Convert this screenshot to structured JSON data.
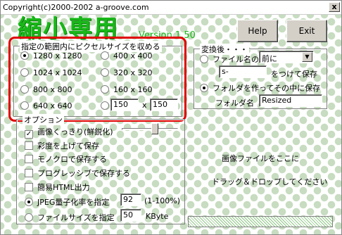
{
  "window": {
    "title": "Copyright(c)2000-2002 a-groove.com",
    "close_label": "x",
    "logo": "縮小専用",
    "version": "Version 1.50"
  },
  "buttons": {
    "help": "Help",
    "exit": "Exit"
  },
  "size_group": {
    "legend": "指定の範囲内にピクセルサイズを収める",
    "options": [
      "1280 x 1280",
      "400 x 400",
      "1024 x 1024",
      "320 x 320",
      "800 x 800",
      "160 x 160",
      "640 x 640"
    ],
    "custom_width": "150",
    "custom_x": "x",
    "custom_height": "150"
  },
  "convert_group": {
    "legend": "変換後・・・",
    "filename_label": "ファイル名の",
    "position_select": "前に",
    "prefix_value": "s-",
    "prefix_suffix_label": "をつけて保存",
    "folder_option_label": "フォルダを作ってその中に保存",
    "folder_name_label": "フォルダ名",
    "folder_name_value": "Resized"
  },
  "options_group": {
    "legend": "オプション",
    "sharpen": "画像くっきり(鮮鋭化)",
    "saturation": "彩度を上げて保存",
    "monochrome": "モノクロで保存する",
    "progressive": "プログレッシブで保存する",
    "simple_html": "簡易HTML出力",
    "jpeg_quality_label": "JPEG量子化率を指定",
    "jpeg_quality_value": "92",
    "jpeg_quality_range": "(1-100%)",
    "file_size_label": "ファイルサイズを指定",
    "file_size_value": "50",
    "file_size_unit": "KByte"
  },
  "drop_area": {
    "line1": "画像ファイルをここに",
    "line2": "ドラッグ＆ドロップしてください"
  }
}
